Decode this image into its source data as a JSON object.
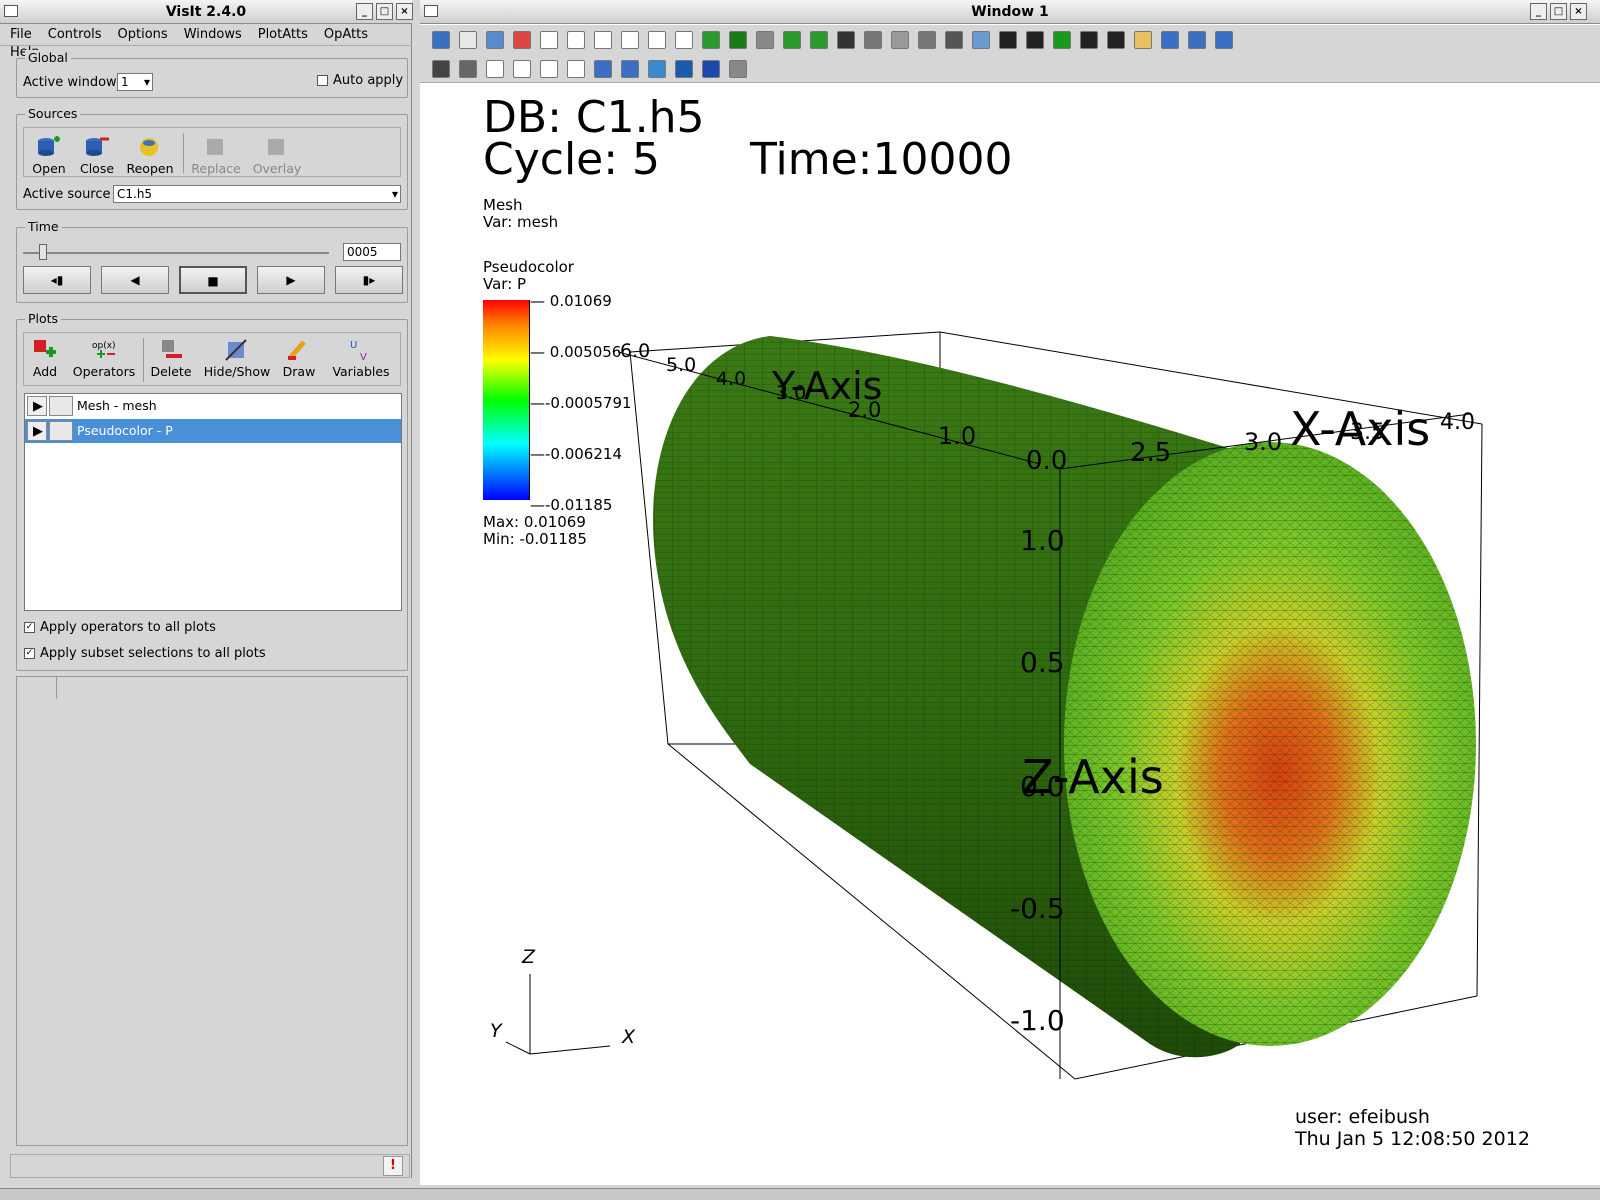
{
  "main_window": {
    "title": "VisIt 2.4.0",
    "menu": [
      "File",
      "Controls",
      "Options",
      "Windows",
      "PlotAtts",
      "OpAtts",
      "Help"
    ],
    "global": {
      "label": "Global",
      "active_window_label": "Active window",
      "active_window_value": "1",
      "auto_apply_label": "Auto apply"
    },
    "sources": {
      "label": "Sources",
      "buttons": [
        "Open",
        "Close",
        "Reopen",
        "Replace",
        "Overlay"
      ],
      "active_source_label": "Active source",
      "active_source_value": "C1.h5"
    },
    "time": {
      "label": "Time",
      "state_value": "0005"
    },
    "plots": {
      "label": "Plots",
      "buttons": [
        "Add",
        "Operators",
        "Delete",
        "Hide/Show",
        "Draw",
        "Variables"
      ],
      "items": [
        {
          "label": "Mesh - mesh",
          "selected": false
        },
        {
          "label": "Pseudocolor - P",
          "selected": true
        }
      ],
      "apply_operators_label": "Apply operators to all plots",
      "apply_subset_label": "Apply subset selections to all plots"
    }
  },
  "vis_window": {
    "title": "Window 1",
    "db_line": "DB: C1.h5",
    "cycle_line": "Cycle: 5",
    "time_line": "Time:10000",
    "mesh_legend": {
      "title": "Mesh",
      "var": "Var: mesh"
    },
    "pc_legend": {
      "title": "Pseudocolor",
      "var": "Var: P",
      "labels": [
        "0.01069",
        "0.005056",
        "-0.0005791",
        "-0.006214",
        "-0.01185"
      ],
      "max": "Max:  0.01069",
      "min": "Min: -0.01185"
    },
    "axes": {
      "x_title": "X-Axis",
      "y_title": "Y-Axis",
      "z_title": "Z-Axis",
      "y_ticks": [
        "6.0",
        "5.0",
        "4.0",
        "3.0",
        "2.0",
        "1.0",
        "0.0"
      ],
      "x_ticks": [
        "2.5",
        "3.0",
        "3.5",
        "4.0"
      ],
      "z_ticks": [
        "1.0",
        "0.5",
        "0.0",
        "-0.5",
        "-1.0"
      ]
    },
    "triad": {
      "z": "Z",
      "y": "Y",
      "x": "X"
    },
    "user_line": "user: efeibush",
    "date_line": "Thu Jan  5 12:08:50 2012"
  }
}
